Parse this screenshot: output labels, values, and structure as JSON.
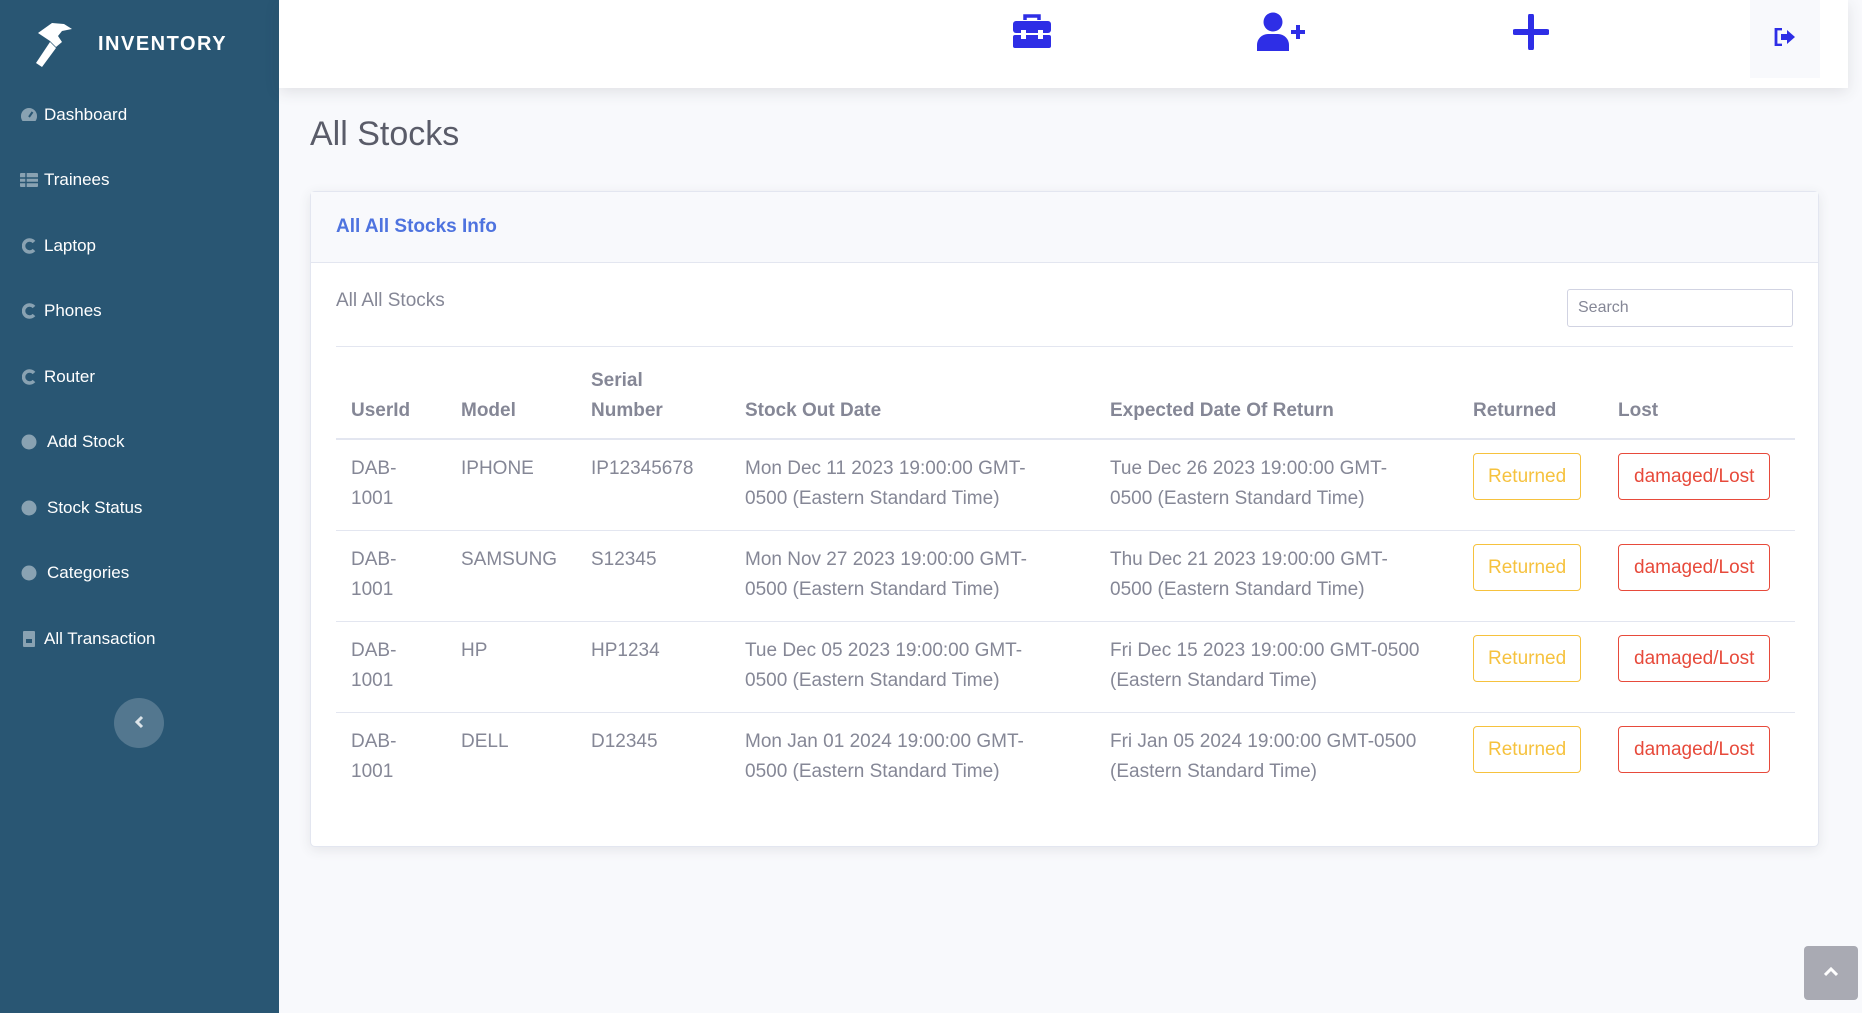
{
  "brand": {
    "name": "INVENTORY",
    "icon": "hammer-icon"
  },
  "sidebar": {
    "items": [
      {
        "label": "Dashboard",
        "icon": "tachometer-icon"
      },
      {
        "label": "Trainees",
        "icon": "table-icon"
      },
      {
        "label": "Laptop",
        "icon": "c-icon"
      },
      {
        "label": "Phones",
        "icon": "c-icon"
      },
      {
        "label": "Router",
        "icon": "c-icon"
      },
      {
        "label": "Add Stock",
        "icon": "circle-icon"
      },
      {
        "label": "Stock Status",
        "icon": "circle-icon"
      },
      {
        "label": "Categories",
        "icon": "circle-icon"
      },
      {
        "label": "All Transaction",
        "icon": "receipt-icon"
      }
    ],
    "toggle": "chevron-left-icon"
  },
  "topbar": {
    "icons": [
      "toolbox-icon",
      "user-plus-icon",
      "plus-icon",
      "sign-out-icon"
    ],
    "accent": "#2e2ee6"
  },
  "page": {
    "title": "All Stocks"
  },
  "card": {
    "header": "All All Stocks Info",
    "subtitle": "All All Stocks",
    "search_placeholder": "Search"
  },
  "table": {
    "columns": [
      "UserId",
      "Model",
      "Serial Number",
      "Stock Out Date",
      "Expected Date Of Return",
      "Returned",
      "Lost"
    ],
    "rows": [
      {
        "userid": "DAB-1001",
        "model": "IPHONE",
        "serial": "IP12345678",
        "out": "Mon Dec 11 2023 19:00:00 GMT-0500 (Eastern Standard Time)",
        "ret": "Tue Dec 26 2023 19:00:00 GMT-0500 (Eastern Standard Time)",
        "returned": "Returned",
        "lost": "damaged/Lost"
      },
      {
        "userid": "DAB-1001",
        "model": "SAMSUNG",
        "serial": "S12345",
        "out": "Mon Nov 27 2023 19:00:00 GMT-0500 (Eastern Standard Time)",
        "ret": "Thu Dec 21 2023 19:00:00 GMT-0500 (Eastern Standard Time)",
        "returned": "Returned",
        "lost": "damaged/Lost"
      },
      {
        "userid": "DAB-1001",
        "model": "HP",
        "serial": "HP1234",
        "out": "Tue Dec 05 2023 19:00:00 GMT-0500 (Eastern Standard Time)",
        "ret": "Fri Dec 15 2023 19:00:00 GMT-0500 (Eastern Standard Time)",
        "returned": "Returned",
        "lost": "damaged/Lost"
      },
      {
        "userid": "DAB-1001",
        "model": "DELL",
        "serial": "D12345",
        "out": "Mon Jan 01 2024 19:00:00 GMT-0500 (Eastern Standard Time)",
        "ret": "Fri Jan 05 2024 19:00:00 GMT-0500 (Eastern Standard Time)",
        "returned": "Returned",
        "lost": "damaged/Lost"
      }
    ]
  },
  "colors": {
    "sidebar": "#295673",
    "primary": "#4e73df",
    "warning": "#f6c23e",
    "danger": "#e74a3b"
  }
}
